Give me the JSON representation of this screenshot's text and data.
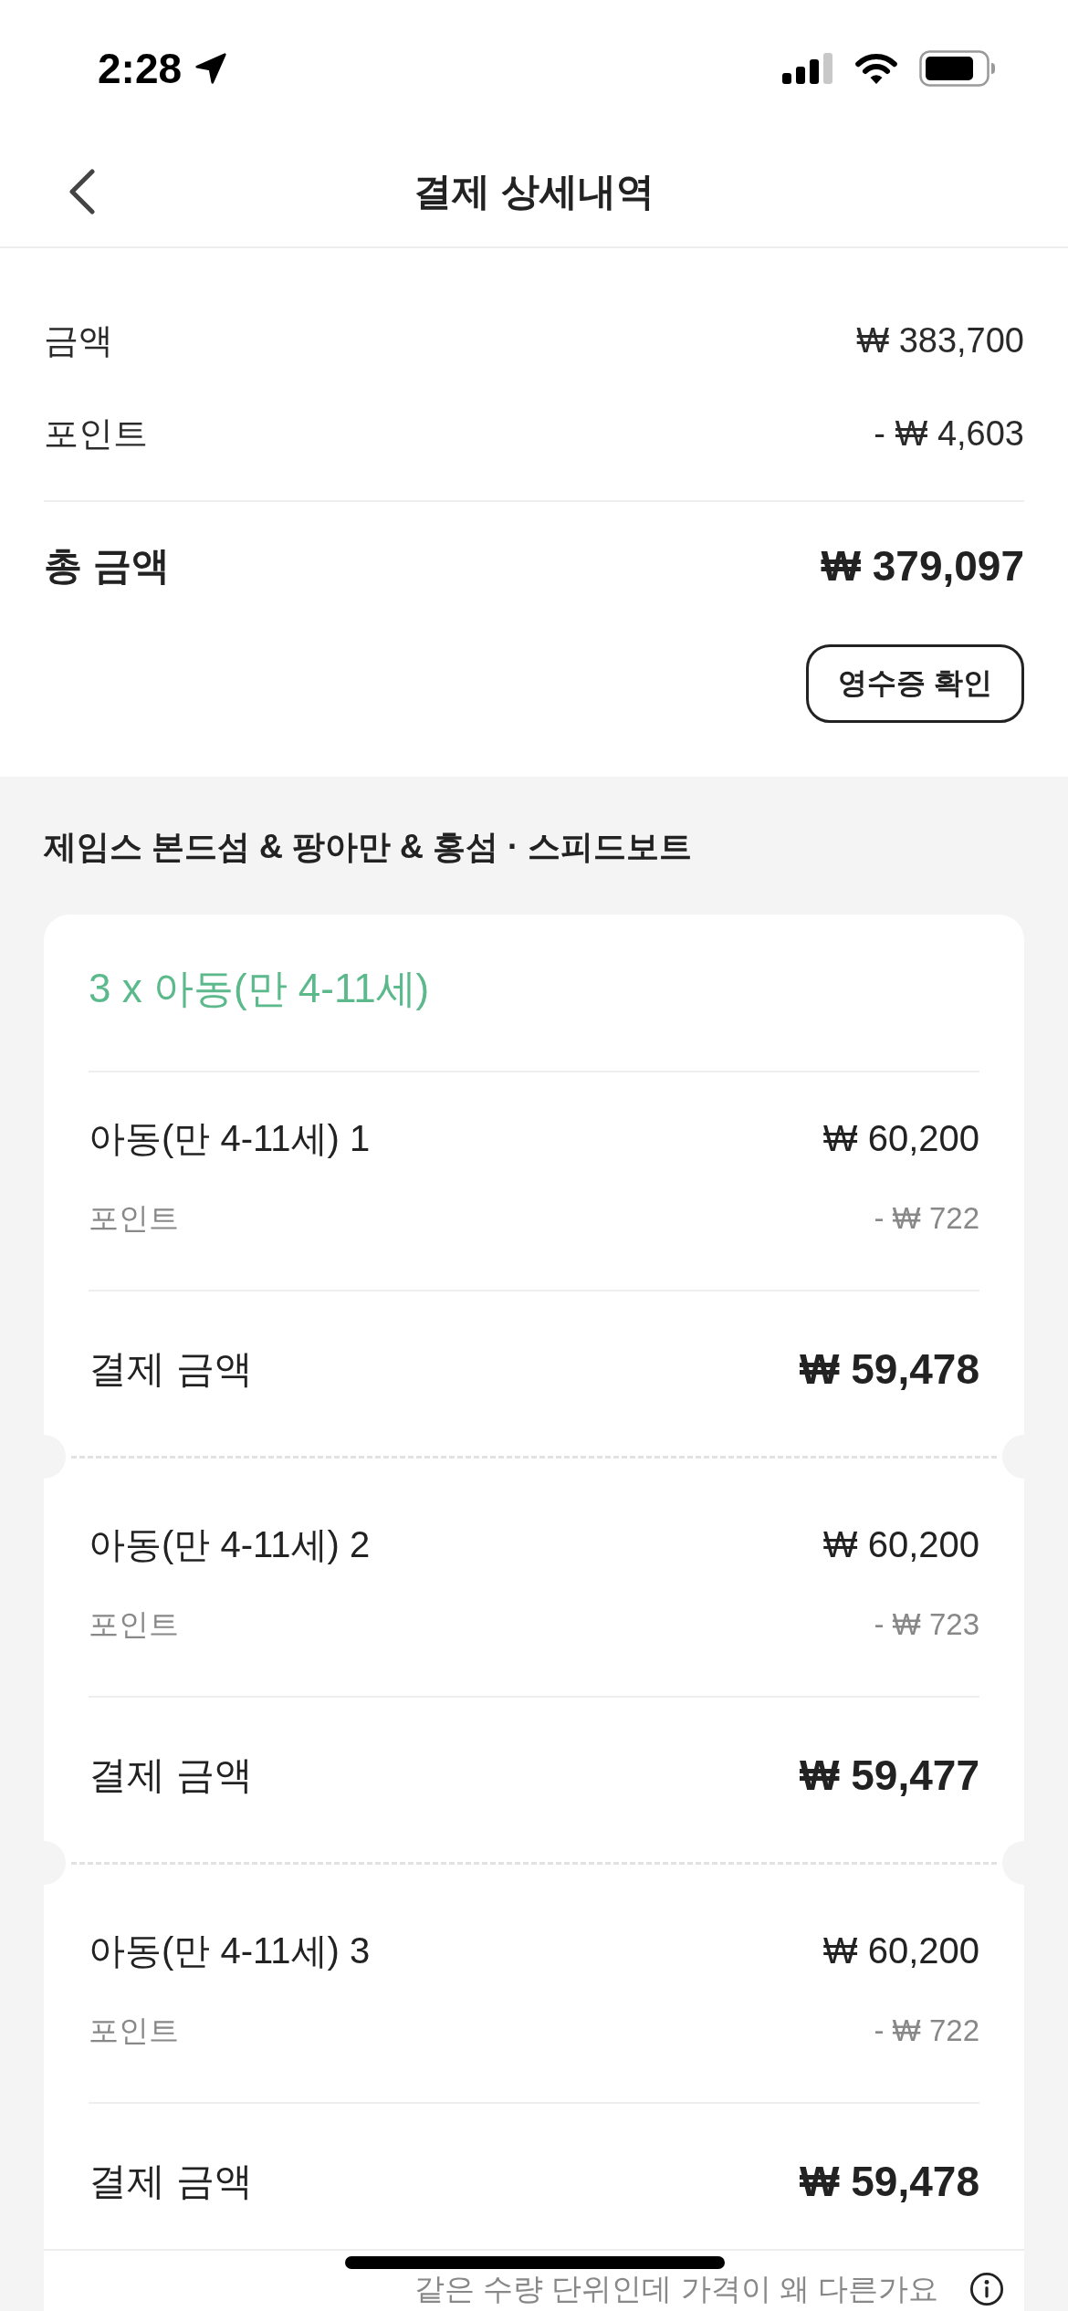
{
  "status_bar": {
    "time": "2:28"
  },
  "nav": {
    "title": "결제 상세내역"
  },
  "summary": {
    "rows": [
      {
        "label": "금액",
        "value": "₩ 383,700"
      },
      {
        "label": "포인트",
        "value": "- ₩ 4,603"
      }
    ],
    "total": {
      "label": "총 금액",
      "value": "₩ 379,097"
    },
    "receipt_button": "영수증 확인"
  },
  "product": {
    "title": "제임스 본드섬 & 팡아만 & 홍섬 · 스피드보트",
    "group_title": "3 x 아동(만 4-11세)",
    "tickets": [
      {
        "name": "아동(만 4-11세) 1",
        "price": "₩ 60,200",
        "points_label": "포인트",
        "points": "- ₩ 722",
        "paid_label": "결제 금액",
        "paid": "₩ 59,478"
      },
      {
        "name": "아동(만 4-11세) 2",
        "price": "₩ 60,200",
        "points_label": "포인트",
        "points": "- ₩ 723",
        "paid_label": "결제 금액",
        "paid": "₩ 59,477"
      },
      {
        "name": "아동(만 4-11세) 3",
        "price": "₩ 60,200",
        "points_label": "포인트",
        "points": "- ₩ 722",
        "paid_label": "결제 금액",
        "paid": "₩ 59,478"
      }
    ],
    "price_question": "같은 수량 단위인데 가격이 왜 다른가요"
  }
}
